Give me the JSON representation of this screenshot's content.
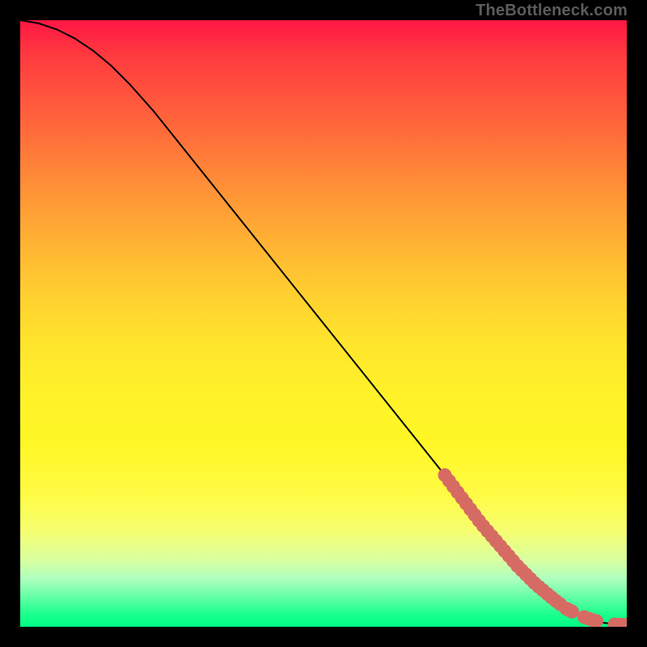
{
  "watermark": "TheBottleneck.com",
  "colors": {
    "curve": "#000000",
    "marker_fill": "#d66b63",
    "marker_stroke": "#d66b63"
  },
  "chart_data": {
    "type": "line",
    "title": "",
    "xlabel": "",
    "ylabel": "",
    "xlim": [
      0,
      100
    ],
    "ylim": [
      0,
      100
    ],
    "x": [
      0,
      3,
      6,
      9,
      12,
      15,
      18,
      22,
      26,
      30,
      34,
      38,
      42,
      46,
      50,
      54,
      58,
      62,
      66,
      70,
      73,
      76,
      79,
      82,
      85,
      88,
      90,
      92,
      94,
      96,
      98,
      100
    ],
    "y": [
      100,
      99.5,
      98.5,
      97,
      95,
      92.5,
      89.5,
      85,
      80,
      75,
      70,
      65,
      60,
      55,
      50,
      45,
      40,
      35,
      30,
      25,
      21,
      17,
      13.5,
      10,
      7,
      4.5,
      3,
      2,
      1.2,
      0.7,
      0.4,
      0.3
    ],
    "mask_segments": [
      {
        "x_start": 70,
        "x_end": 89
      },
      {
        "x_start": 90,
        "x_end": 91
      },
      {
        "x_start": 93,
        "x_end": 95
      },
      {
        "x_start": 98,
        "x_end": 100
      }
    ],
    "marker_radius_px": 8.5
  }
}
